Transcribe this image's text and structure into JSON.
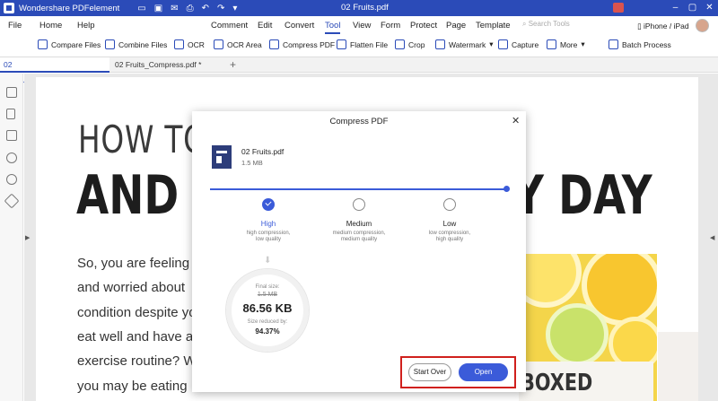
{
  "titlebar": {
    "app_name": "Wondershare PDFelement",
    "doc_title": "02 Fruits.pdf",
    "qa_icons": [
      "folder-icon",
      "save-icon",
      "mail-icon",
      "print-icon",
      "undo-icon",
      "redo-icon",
      "dropdown-icon"
    ],
    "accent": "#2b4bb8"
  },
  "menu": {
    "items": [
      "File",
      "Home",
      "Help",
      "Comment",
      "Edit",
      "Convert",
      "Tool",
      "View",
      "Form",
      "Protect",
      "Page",
      "Template"
    ],
    "active": "Tool",
    "search_placeholder": "Search Tools",
    "device_label": "iPhone / iPad"
  },
  "toolbar": {
    "items": [
      "Compare Files",
      "Combine Files",
      "OCR",
      "OCR Area",
      "Compress PDF",
      "Flatten File",
      "Crop",
      "Watermark",
      "Capture",
      "More",
      "Batch Process"
    ]
  },
  "tabs": [
    {
      "label": "02 Fruits.pdf"
    },
    {
      "label": "02 Fruits_Compress.pdf *"
    }
  ],
  "document": {
    "headline_1": "HOW TO E",
    "headline_2a": "AND F",
    "headline_2b": "Y DAY",
    "body_lines": [
      "So, you are feeling c",
      "and worried about",
      "condition despite yo",
      "eat well and have a",
      "exercise routine? W",
      "you may be eating"
    ],
    "photo_text": "BOXED"
  },
  "dialog": {
    "title": "Compress PDF",
    "file_name": "02 Fruits.pdf",
    "file_size": "1.5 MB",
    "options": [
      {
        "label": "High",
        "desc_1": "high compression,",
        "desc_2": "low quality"
      },
      {
        "label": "Medium",
        "desc_1": "medium compression,",
        "desc_2": "medium quality"
      },
      {
        "label": "Low",
        "desc_1": "low compression,",
        "desc_2": "high quality"
      }
    ],
    "selected": "High",
    "final_size_label": "Final size:",
    "original_size": "1.5 MB",
    "final_size": "86.56 KB",
    "reduced_label": "Size reduced by:",
    "reduced_value": "94.37%",
    "start_over_label": "Start Over",
    "open_label": "Open",
    "accent": "#3b5bd9",
    "highlight_color": "#d0201d"
  }
}
